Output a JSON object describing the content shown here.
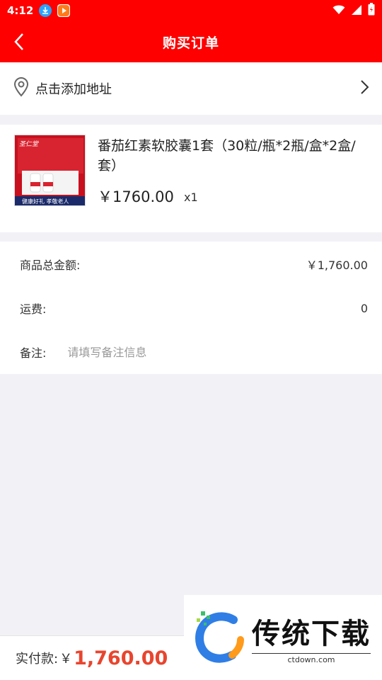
{
  "status_bar": {
    "time": "4:12"
  },
  "header": {
    "title": "购买订单"
  },
  "address": {
    "label": "点击添加地址"
  },
  "product": {
    "name": "番茄红素软胶囊1套（30粒/瓶*2瓶/盒*2盒/套）",
    "price": "￥1760.00",
    "quantity": "x1",
    "thumb_texts": [
      "圣仁堂",
      "健康好礼 孝敬老人"
    ]
  },
  "summary": {
    "total_label": "商品总金额:",
    "total_value": "￥1,760.00",
    "shipping_label": "运费:",
    "shipping_value": "0",
    "remark_label": "备注:",
    "remark_placeholder": "请填写备注信息",
    "remark_value": ""
  },
  "bottom_bar": {
    "pay_label": "实付款:",
    "currency": "￥",
    "amount": "1,760.00"
  },
  "watermark": {
    "title": "传统下载",
    "url": "ctdown.com"
  },
  "colors": {
    "brand_red": "#ff0000",
    "amount_orange": "#e8452e"
  }
}
